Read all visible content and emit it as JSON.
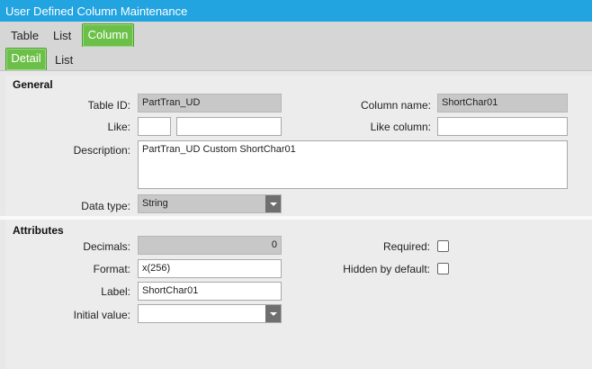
{
  "window": {
    "title": "User Defined Column Maintenance"
  },
  "tabs_top": [
    {
      "label": "Table"
    },
    {
      "label": "List"
    },
    {
      "label": "Column",
      "active": true
    }
  ],
  "tabs_sub": [
    {
      "label": "Detail",
      "active": true
    },
    {
      "label": "List"
    }
  ],
  "general": {
    "title": "General",
    "table_id_label": "Table ID:",
    "table_id_value": "PartTran_UD",
    "column_name_label": "Column name:",
    "column_name_value": "ShortChar01",
    "like_label": "Like:",
    "like_value_1": "",
    "like_value_2": "",
    "like_column_label": "Like column:",
    "like_column_value": "",
    "description_label": "Description:",
    "description_value": "PartTran_UD Custom ShortChar01",
    "data_type_label": "Data type:",
    "data_type_value": "String"
  },
  "attributes": {
    "title": "Attributes",
    "decimals_label": "Decimals:",
    "decimals_value": "0",
    "format_label": "Format:",
    "format_value": "x(256)",
    "label_label": "Label:",
    "label_value": "ShortChar01",
    "initial_value_label": "Initial value:",
    "initial_value_value": "",
    "required_label": "Required:",
    "required_checked": false,
    "hidden_label": "Hidden by default:",
    "hidden_checked": false
  },
  "colors": {
    "accent": "#22a4e1",
    "active_tab": "#6cc04a"
  }
}
